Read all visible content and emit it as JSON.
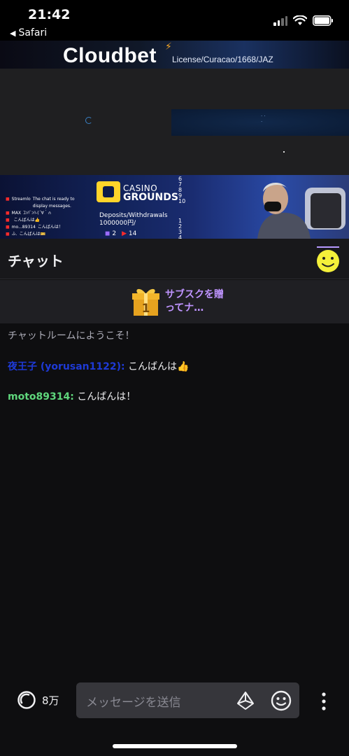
{
  "status": {
    "time": "21:42",
    "back_label": "Safari"
  },
  "banner": {
    "logo_text": "Cloudbet",
    "license_text": "License/Curacao/1668/JAZ"
  },
  "overlay": {
    "chat_lines": [
      {
        "name": "Streamlo",
        "text": "The chat is ready to display messages."
      },
      {
        "name": "MAX",
        "text": "ｺﾝﾊﾞﾝﾊ-(´∀｀∩"
      },
      {
        "name": "",
        "text": "こんばんは👍"
      },
      {
        "name": "mo...89314",
        "text": "こんばんは！"
      },
      {
        "name": "ふ.",
        "text": "こんばんは🎫"
      }
    ],
    "brand_top": "CASINO",
    "brand_bottom": "GROUNDS",
    "deposits_label": "Deposits/Withdrawals",
    "deposits_value": "1000000円/",
    "twitch_count": "2",
    "youtube_count": "14",
    "numbers_top": [
      "6",
      "7",
      "8",
      "9",
      "10"
    ],
    "numbers_bottom": [
      "1",
      "2",
      "3",
      "4"
    ]
  },
  "chat": {
    "title": "チャット",
    "sub_banner_text": "サブスクを贈ってナ…",
    "gift_count": "1",
    "welcome": "チャットルームにようこそ！",
    "messages": [
      {
        "user": "夜王子 (yorusan1122):",
        "text": "こんばんは👍",
        "color": "#1e3ad6"
      },
      {
        "user": "moto89314:",
        "text": "こんばんは！",
        "color": "#5fd67c"
      }
    ]
  },
  "bottom": {
    "viewer_count": "8万",
    "input_placeholder": "メッセージを送信"
  },
  "colors": {
    "accent_purple": "#bf94ff",
    "background": "#0e0e10"
  },
  "icons": {
    "viewers": "spinner-ring-icon",
    "bits": "bits-diamond-icon",
    "emote": "smiley-emote-icon",
    "more": "vertical-dots-icon",
    "gift": "gift-box-icon",
    "mod": "smiley-face-icon"
  }
}
